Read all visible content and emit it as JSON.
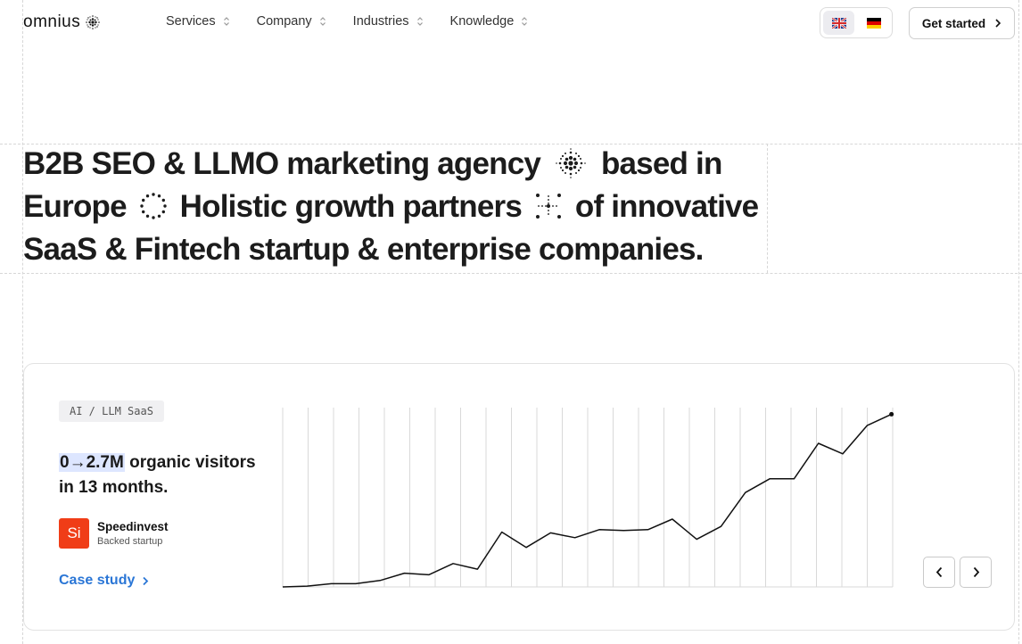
{
  "brand": {
    "name": "omnius"
  },
  "nav": {
    "items": [
      {
        "label": "Services"
      },
      {
        "label": "Company"
      },
      {
        "label": "Industries"
      },
      {
        "label": "Knowledge"
      }
    ]
  },
  "language": {
    "options": [
      {
        "code": "EN",
        "icon": "uk-flag-icon",
        "active": true
      },
      {
        "code": "DE",
        "icon": "germany-flag-icon",
        "active": false
      }
    ]
  },
  "header": {
    "cta_label": "Get started"
  },
  "hero": {
    "part1": "B2B SEO & LLMO marketing agency",
    "part2": "based in Europe",
    "part3": "Holistic growth partners",
    "part4": "of innovative SaaS & Fintech startup & enterprise companies."
  },
  "case": {
    "tag": "AI / LLM SaaS",
    "highlight": "0→2.7M",
    "headline_rest": " organic visitors in 13 months.",
    "company": {
      "logo_text": "Si",
      "name": "Speedinvest",
      "subtitle": "Backed startup"
    },
    "link_label": "Case study"
  },
  "colors": {
    "accent_link": "#2a76d6",
    "highlight": "#dde6ff",
    "company_logo": "#f03d17",
    "text": "#1a1a1a"
  },
  "chart_data": {
    "type": "line",
    "title": "",
    "xlabel": "",
    "ylabel": "",
    "grid": "vertical",
    "x": [
      0,
      1,
      2,
      3,
      4,
      5,
      6,
      7,
      8,
      9,
      10,
      11,
      12,
      13,
      14,
      15,
      16,
      17,
      18,
      19,
      20,
      21,
      22,
      23,
      24
    ],
    "values": [
      0,
      0.01,
      0.04,
      0.04,
      0.08,
      0.17,
      0.15,
      0.29,
      0.22,
      0.68,
      0.49,
      0.67,
      0.61,
      0.71,
      0.7,
      0.71,
      0.84,
      0.59,
      0.75,
      1.17,
      1.34,
      1.34,
      1.78,
      1.65,
      2.0,
      2.14
    ],
    "ylim": [
      0,
      2.2
    ],
    "end_marker": true
  }
}
